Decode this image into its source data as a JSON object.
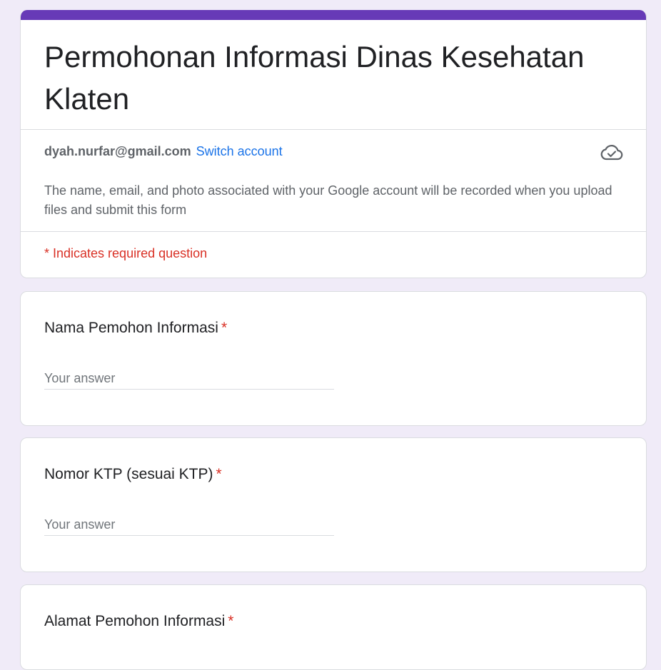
{
  "form": {
    "title": "Permohonan Informasi Dinas Kesehatan Klaten",
    "accent_color": "#673ab7",
    "account": {
      "email": "dyah.nurfar@gmail.com",
      "switch_label": "Switch account",
      "status_icon": "cloud-check-icon"
    },
    "notice": "The name, email, and photo associated with your Google account will be recorded when you upload files and submit this form",
    "required_note": "* Indicates required question"
  },
  "questions": [
    {
      "title": "Nama Pemohon Informasi",
      "required_mark": "*",
      "placeholder": "Your answer"
    },
    {
      "title": "Nomor KTP (sesuai KTP)",
      "required_mark": "*",
      "placeholder": "Your answer"
    },
    {
      "title": "Alamat Pemohon Informasi",
      "required_mark": "*"
    }
  ]
}
